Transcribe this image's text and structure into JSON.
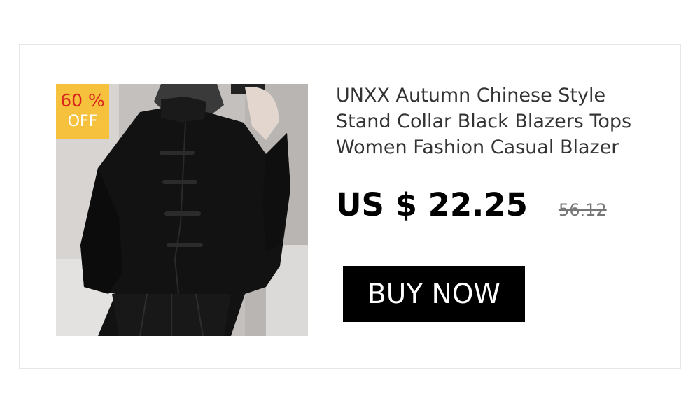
{
  "product": {
    "title": "UNXX Autumn Chinese Style Stand Collar Black Blazers Tops Women Fashion Casual Blazer",
    "current_price": "US $ 22.25",
    "original_price": "56.12",
    "image_icon": "product-photo"
  },
  "badge": {
    "percent": "60 %",
    "off": "OFF",
    "background_color": "#f6c23d",
    "percent_color": "#d8241d"
  },
  "actions": {
    "buy_label": "BUY NOW"
  }
}
